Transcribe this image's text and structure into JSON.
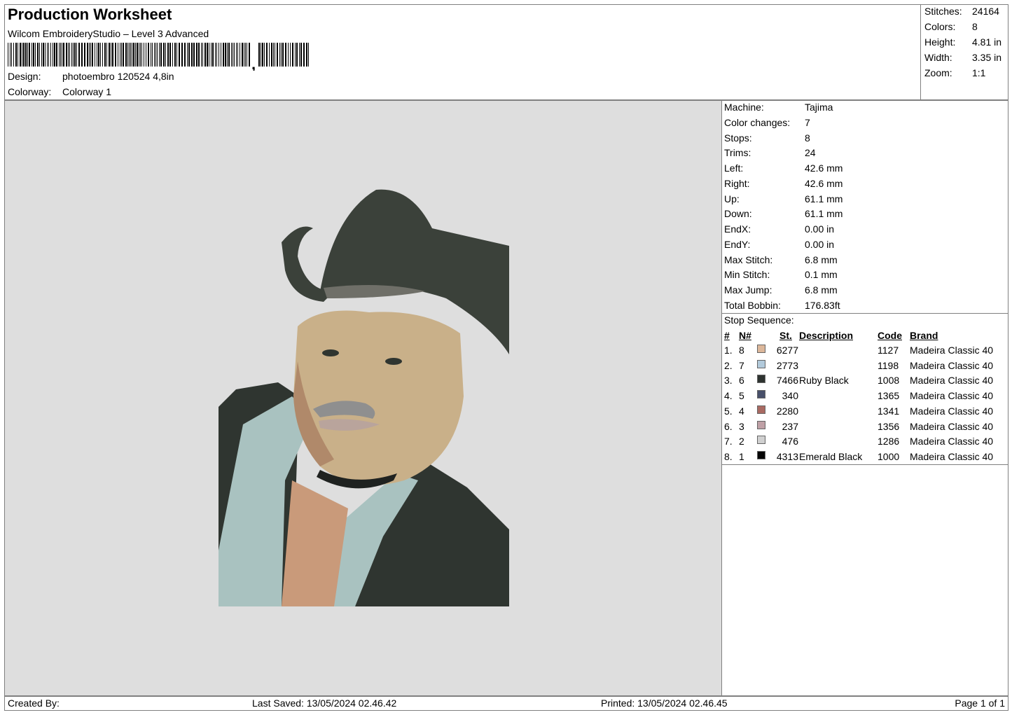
{
  "header": {
    "title": "Production Worksheet",
    "subtitle": "Wilcom EmbroideryStudio – Level 3 Advanced",
    "design_label": "Design:",
    "design_value": "photoembro 120524 4,8in",
    "colorway_label": "Colorway:",
    "colorway_value": "Colorway 1"
  },
  "summary": {
    "stitches_label": "Stitches:",
    "stitches": "24164",
    "colors_label": "Colors:",
    "colors": "8",
    "height_label": "Height:",
    "height": "4.81 in",
    "width_label": "Width:",
    "width": "3.35 in",
    "zoom_label": "Zoom:",
    "zoom": "1:1"
  },
  "machine_info": [
    {
      "label": "Machine:",
      "value": "Tajima"
    },
    {
      "label": "Color changes:",
      "value": "7"
    },
    {
      "label": "Stops:",
      "value": "8"
    },
    {
      "label": "Trims:",
      "value": "24"
    },
    {
      "label": "Left:",
      "value": "42.6 mm"
    },
    {
      "label": "Right:",
      "value": "42.6 mm"
    },
    {
      "label": "Up:",
      "value": "61.1 mm"
    },
    {
      "label": "Down:",
      "value": "61.1 mm"
    },
    {
      "label": "EndX:",
      "value": "0.00 in"
    },
    {
      "label": "EndY:",
      "value": "0.00 in"
    },
    {
      "label": "Max Stitch:",
      "value": "6.8 mm"
    },
    {
      "label": "Min Stitch:",
      "value": "0.1 mm"
    },
    {
      "label": "Max Jump:",
      "value": "6.8 mm"
    },
    {
      "label": "Total Bobbin:",
      "value": "176.83ft"
    }
  ],
  "stop_sequence": {
    "title": "Stop Sequence:",
    "columns": {
      "num": "#",
      "n": "N#",
      "st": "St.",
      "description": "Description",
      "code": "Code",
      "brand": "Brand"
    },
    "rows": [
      {
        "num": "1.",
        "n": "8",
        "color": "#dcb79a",
        "st": "6277",
        "description": "",
        "code": "1127",
        "brand": "Madeira Classic 40"
      },
      {
        "num": "2.",
        "n": "7",
        "color": "#b2cadb",
        "st": "2773",
        "description": "",
        "code": "1198",
        "brand": "Madeira Classic 40"
      },
      {
        "num": "3.",
        "n": "6",
        "color": "#2e3330",
        "st": "7466",
        "description": "Ruby Black",
        "code": "1008",
        "brand": "Madeira Classic 40"
      },
      {
        "num": "4.",
        "n": "5",
        "color": "#48506a",
        "st": "340",
        "description": "",
        "code": "1365",
        "brand": "Madeira Classic 40"
      },
      {
        "num": "5.",
        "n": "4",
        "color": "#a96a62",
        "st": "2280",
        "description": "",
        "code": "1341",
        "brand": "Madeira Classic 40"
      },
      {
        "num": "6.",
        "n": "3",
        "color": "#bfa0a6",
        "st": "237",
        "description": "",
        "code": "1356",
        "brand": "Madeira Classic 40"
      },
      {
        "num": "7.",
        "n": "2",
        "color": "#d0d0d0",
        "st": "476",
        "description": "",
        "code": "1286",
        "brand": "Madeira Classic 40"
      },
      {
        "num": "8.",
        "n": "1",
        "color": "#050505",
        "st": "4313",
        "description": "Emerald Black",
        "code": "1000",
        "brand": "Madeira Classic 40"
      }
    ]
  },
  "footer": {
    "created_by": "Created By:",
    "last_saved": "Last Saved: 13/05/2024 02.46.42",
    "printed": "Printed: 13/05/2024 02.46.45",
    "page": "Page 1 of 1"
  },
  "colors": {
    "canvas_bg": "#dedede",
    "border": "#808080"
  }
}
